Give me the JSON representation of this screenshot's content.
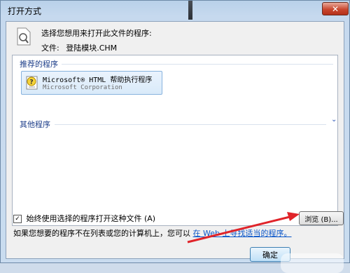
{
  "window": {
    "title": "打开方式",
    "close_label": "✕"
  },
  "header": {
    "prompt": "选择您想用来打开此文件的程序:",
    "file_label": "文件:",
    "file_name": "登陆模块.CHM"
  },
  "groups": {
    "recommended": {
      "label": "推荐的程序",
      "items": [
        {
          "name": "Microsoft® HTML 帮助执行程序",
          "publisher": "Microsoft Corporation"
        }
      ]
    },
    "other": {
      "label": "其他程序"
    }
  },
  "options": {
    "always_use": "始终使用选择的程序打开这种文件 (A)",
    "always_use_checked": true
  },
  "buttons": {
    "browse": "浏览 (B)...",
    "ok": "确定"
  },
  "footer": {
    "hint_prefix": "如果您想要的程序不在列表或您的计算机上，您可以",
    "hint_link": "在 Web 上寻找适当的程序。"
  },
  "colors": {
    "accent": "#1e3f8a",
    "link": "#0b56c9",
    "annotation_arrow": "#e0242a"
  }
}
